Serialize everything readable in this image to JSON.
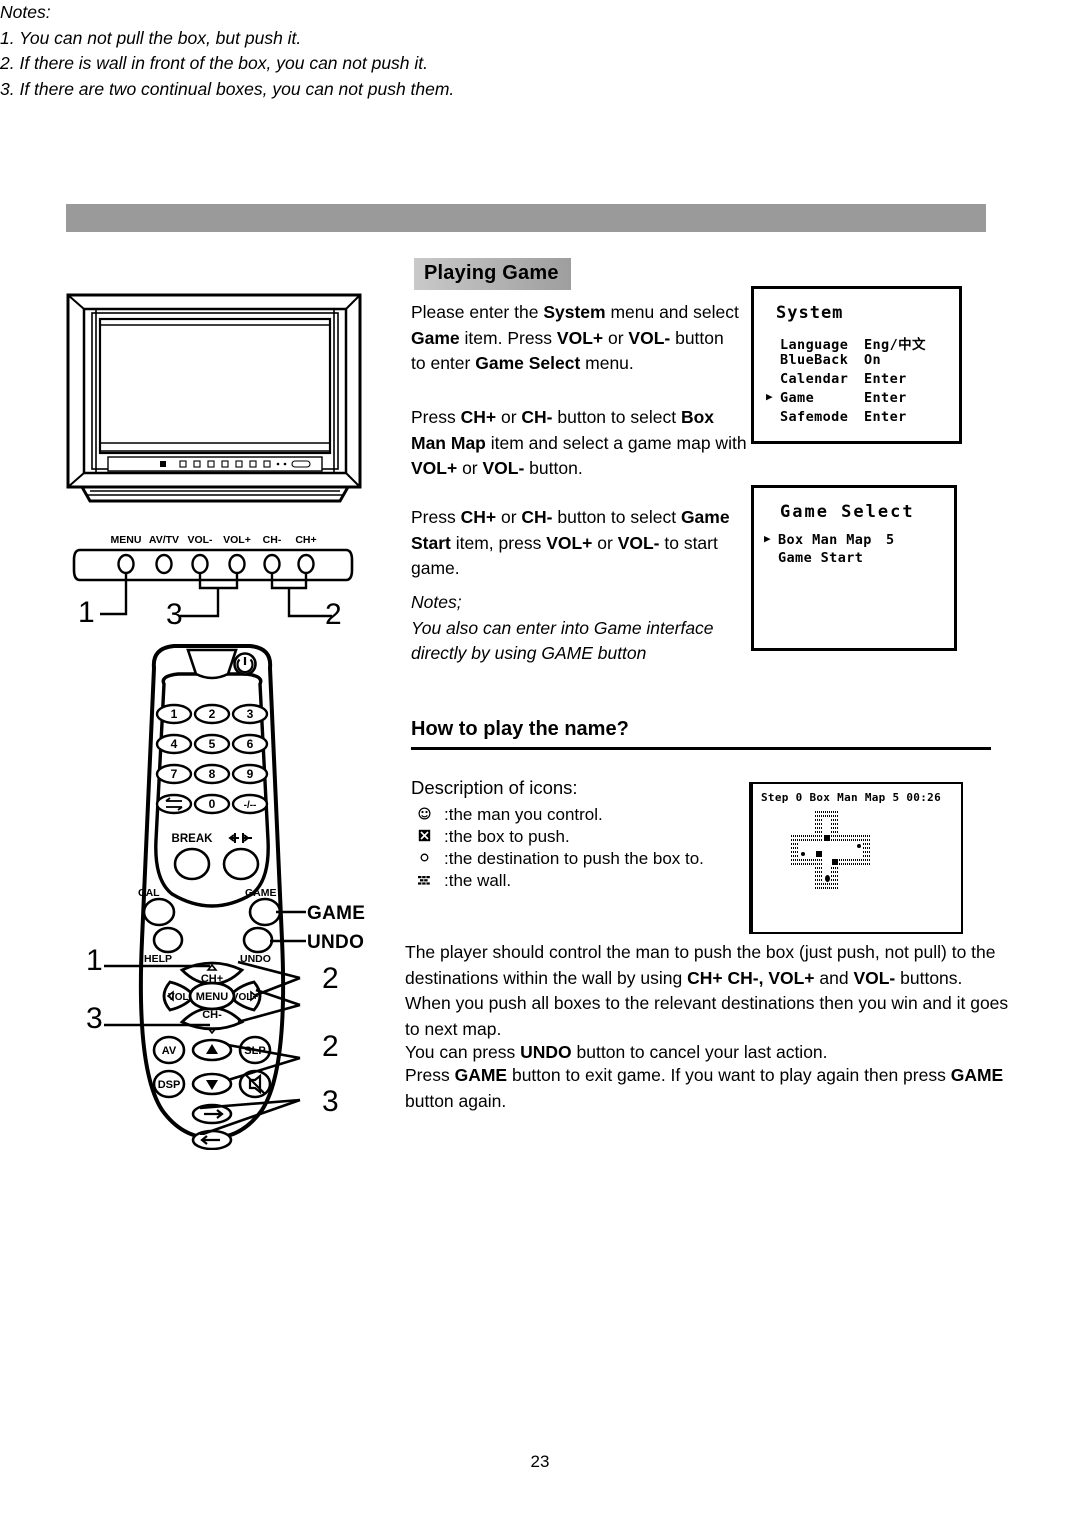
{
  "page": {
    "number": "23",
    "section_title": "Playing Game",
    "subsection_title": "How to play the name?"
  },
  "instructions": {
    "p1_line1_a": "Please enter the ",
    "p1_sys": "System",
    "p1_line1_b": " menu and select ",
    "p1_game": "Game",
    "p1_line1_c": " item.",
    "p1_line2_a": "Press ",
    "p1_volplus": "VOL+",
    "p1_or": " or ",
    "p1_volminus": "VOL-",
    "p1_line2_b": " button to enter ",
    "p1_gameselect": "Game Select",
    "p1_line2_c": " menu.",
    "p2_a": "Press ",
    "p2_chplus": "CH+",
    "p2_or": " or ",
    "p2_chminus": "CH-",
    "p2_b": " button to select ",
    "p2_boxmanmap": "Box Man Map",
    "p2_c": " item and select a game map with ",
    "p2_volplus": "VOL+",
    "p2_or2": " or ",
    "p2_volminus": "VOL-",
    "p2_d": " button.",
    "p3_a": "Press ",
    "p3_chplus": "CH+",
    "p3_or": " or ",
    "p3_chminus": "CH-",
    "p3_b": " button to select ",
    "p3_gamestart": "Game Start",
    "p3_c": " item, press ",
    "p3_volplus": "VOL+",
    "p3_d": " or ",
    "p3_volminus": "VOL-",
    "p3_e": " to start game.",
    "notes1_head": "Notes;",
    "notes1_body": "You also can enter into Game interface directly by using GAME button"
  },
  "icons_section": {
    "heading": "Description of icons:",
    "items": [
      {
        "icon": "man-icon",
        "text": ":the man you control."
      },
      {
        "icon": "box-icon",
        "text": ":the box to push."
      },
      {
        "icon": "destination-icon",
        "text": ":the destination to push the box to."
      },
      {
        "icon": "wall-icon",
        "text": ":the wall."
      }
    ]
  },
  "gameplay": {
    "p4_a": "The player should control the man to push the box (just push, not pull) to the destinations within the wall by using ",
    "p4_btn1": "CH+ CH-,",
    "p4_b": " ",
    "p4_btn2": "VOL+",
    "p4_c": " and ",
    "p4_btn3": "VOL-",
    "p4_d": " buttons. When you push all boxes to the relevant destinations then you win and it goes to next map.",
    "p5_a": "You can press ",
    "p5_undo": "UNDO",
    "p5_b": " button to cancel your last action.",
    "p6_a": "Press ",
    "p6_game1": "GAME",
    "p6_b": " button to exit game. If you want to play again then press ",
    "p6_game2": "GAME",
    "p6_c": " button again.",
    "notes_head": "Notes:",
    "note1": "1. You can not pull the box, but push it.",
    "note2": "2. If there is wall in front of the box, you can not push it.",
    "note3": "3. If there are two continual boxes, you can not push them."
  },
  "osd_system": {
    "title": "System",
    "rows": [
      {
        "cursor": "",
        "label": "Language",
        "value": "Eng/中文"
      },
      {
        "cursor": "",
        "label": "BlueBack",
        "value": "On"
      },
      {
        "cursor": "",
        "label": "Calendar",
        "value": "Enter"
      },
      {
        "cursor": "▶",
        "label": "Game",
        "value": "Enter"
      },
      {
        "cursor": "",
        "label": "Safemode",
        "value": "Enter"
      }
    ]
  },
  "osd_gameselect": {
    "title": "Game Select",
    "rows": [
      {
        "cursor": "▶",
        "label": "Box Man Map",
        "value": "5"
      },
      {
        "cursor": "",
        "label": "Game Start",
        "value": ""
      }
    ]
  },
  "game_screen": {
    "status_step_label": "Step",
    "status_step_value": "0",
    "status_map_label": "Box Man Map",
    "status_map_value": "5",
    "status_time": "00:26",
    "status_full": "Step 0  Box Man Map 5  00:26",
    "grid": [
      ". . . . w w w . . . .",
      ". . . . w . w . . . .",
      ". . . . w . w . . . .",
      ". w w w w b w w w w w",
      ". w . . . . . . . d w",
      ". w d . b . . . . . w",
      ". w w w w . b w w w w",
      ". . . . w . w . . . .",
      ". . . . w m w . . . .",
      ". . . . w w w . . . ."
    ],
    "legend": {
      "w": "wall",
      "b": "box",
      "d": "destination",
      "m": "man",
      ".": "empty"
    }
  },
  "tv_diagram": {
    "button_labels": [
      "MENU",
      "AV/TV",
      "VOL-",
      "VOL+",
      "CH-",
      "CH+"
    ],
    "callouts": [
      "1",
      "3",
      "2"
    ]
  },
  "remote_diagram": {
    "keypad": [
      "1",
      "2",
      "3",
      "4",
      "5",
      "6",
      "7",
      "8",
      "9",
      "recall",
      "0",
      "-/--"
    ],
    "break_label": "BREAK",
    "cal_label": "CAL",
    "game_label": "GAME",
    "help_label": "HELP",
    "undo_label": "UNDO",
    "nav": {
      "up": "CH+",
      "down": "CH-",
      "left": "VOL-",
      "right": "VOL+",
      "center": "MENU"
    },
    "side_buttons": [
      "AV",
      "DSP",
      "SLP"
    ],
    "annotations": {
      "game": "GAME",
      "undo": "UNDO"
    },
    "callouts_left": [
      "1",
      "3"
    ],
    "callouts_right": [
      "2",
      "2",
      "3"
    ]
  },
  "colors": {
    "header_bar": "#9a9a9a",
    "title_gradient_from": "#c9c9c9",
    "title_gradient_to": "#9e9e9e",
    "ink": "#000000",
    "paper": "#ffffff"
  }
}
